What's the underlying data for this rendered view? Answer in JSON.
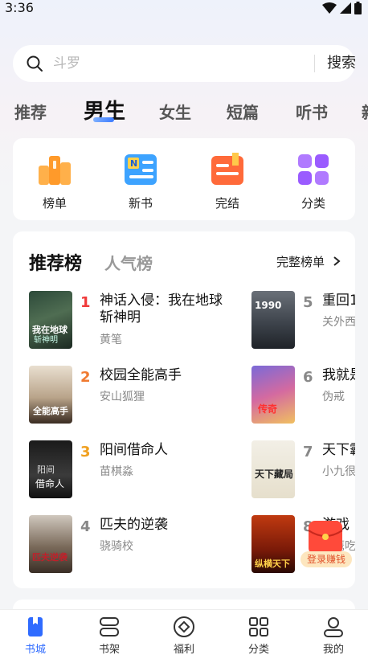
{
  "status": {
    "time": "3:36"
  },
  "search": {
    "placeholder": "斗罗",
    "button_label": "搜索"
  },
  "tabs": [
    "推荐",
    "男生",
    "女生",
    "短篇",
    "听书",
    "新"
  ],
  "active_tab": "男生",
  "quick_links": [
    {
      "label": "榜单",
      "icon": "podium-icon"
    },
    {
      "label": "新书",
      "icon": "new-book-icon"
    },
    {
      "label": "完结",
      "icon": "finished-book-icon"
    },
    {
      "label": "分类",
      "icon": "category-grid-icon"
    }
  ],
  "ranking": {
    "title": "推荐榜",
    "subtitle": "人气榜",
    "full_list_label": "完整榜单",
    "books": [
      {
        "rank": "1",
        "title": "神话入侵：我在地球斩神明",
        "author": "黄笔"
      },
      {
        "rank": "2",
        "title": "校园全能高手",
        "author": "安山狐狸"
      },
      {
        "rank": "3",
        "title": "阳间借命人",
        "author": "苗棋淼"
      },
      {
        "rank": "4",
        "title": "匹夫的逆袭",
        "author": "骁骑校"
      },
      {
        "rank": "5",
        "title": "重回1",
        "author": "关外西"
      },
      {
        "rank": "6",
        "title": "我就是",
        "author": "伪戒"
      },
      {
        "rank": "7",
        "title": "天下霸",
        "author": "小九很"
      },
      {
        "rank": "8",
        "title": "游戏",
        "author": "老鹰吃"
      }
    ]
  },
  "promo": {
    "label": "登录赚钱"
  },
  "bottom_nav": [
    {
      "label": "书城",
      "icon": "bookstore-icon",
      "active": true
    },
    {
      "label": "书架",
      "icon": "bookshelf-icon",
      "active": false
    },
    {
      "label": "福利",
      "icon": "welfare-icon",
      "active": false
    },
    {
      "label": "分类",
      "icon": "category-icon",
      "active": false
    },
    {
      "label": "我的",
      "icon": "profile-icon",
      "active": false
    }
  ],
  "colors": {
    "accent": "#2f6bff",
    "rank1": "#f03a3a",
    "rank2": "#f07a30",
    "rank3": "#f0a020"
  }
}
